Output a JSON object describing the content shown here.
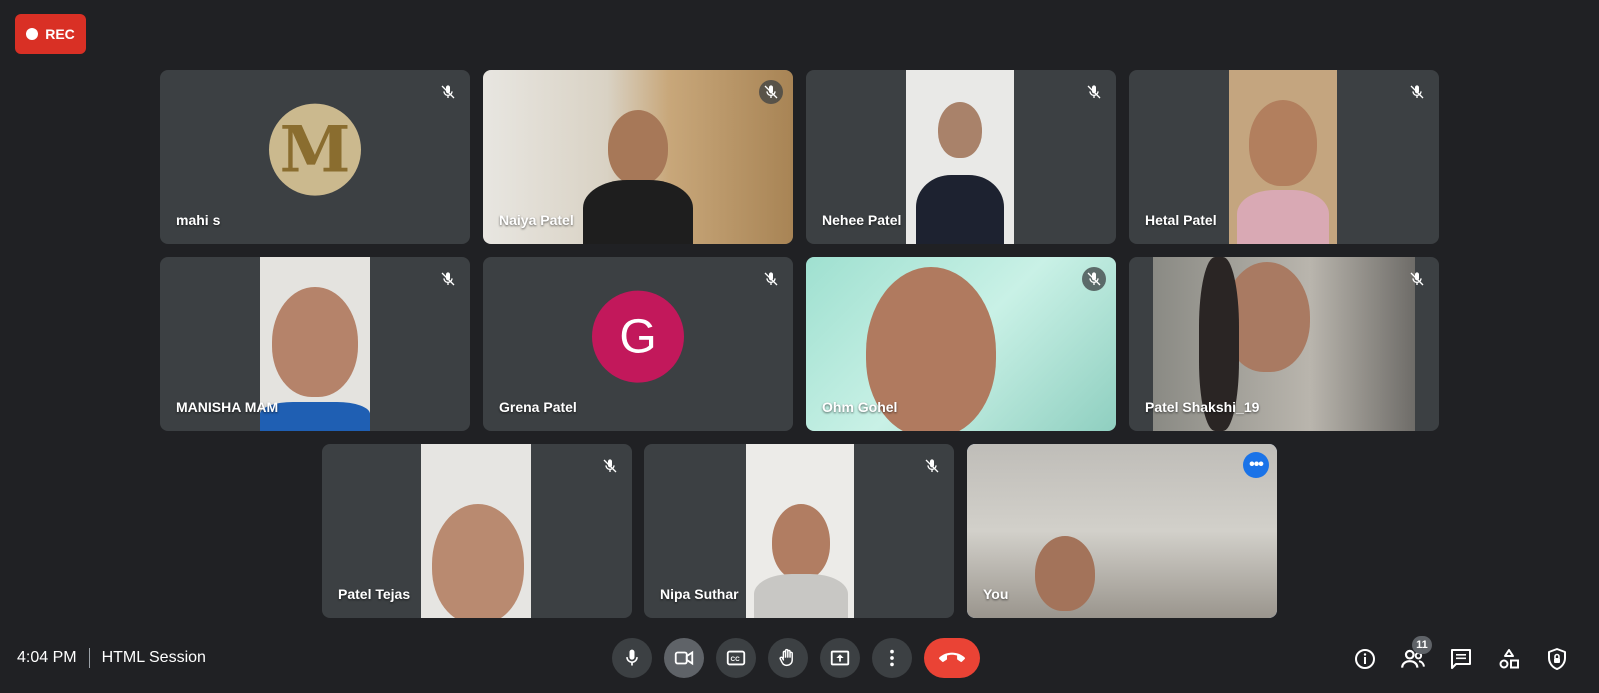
{
  "recording": {
    "label": "REC"
  },
  "participants": [
    {
      "name": "mahi s"
    },
    {
      "name": "Naiya Patel"
    },
    {
      "name": "Nehee Patel"
    },
    {
      "name": "Hetal Patel"
    },
    {
      "name": "MANISHA MAM"
    },
    {
      "name": "Grena Patel",
      "avatar_letter": "G"
    },
    {
      "name": "Ohm Gohel"
    },
    {
      "name": "Patel Shakshi_19"
    },
    {
      "name": "Patel Tejas"
    },
    {
      "name": "Nipa Suthar"
    },
    {
      "name": "You"
    }
  ],
  "mahi_avatar_letter": "M",
  "meeting": {
    "time": "4:04 PM",
    "title": "HTML Session"
  },
  "people_count": "11",
  "colors": {
    "accent": "#1a73e8",
    "end_call": "#ea4335",
    "rec": "#d93025",
    "avatar_g": "#c2185b"
  },
  "controls": [
    "mic-icon",
    "camera-icon",
    "captions-icon",
    "raise-hand-icon",
    "present-icon",
    "more-options-icon",
    "end-call-icon"
  ],
  "right_controls": [
    "info-icon",
    "people-icon",
    "chat-icon",
    "activities-icon",
    "host-controls-icon"
  ]
}
